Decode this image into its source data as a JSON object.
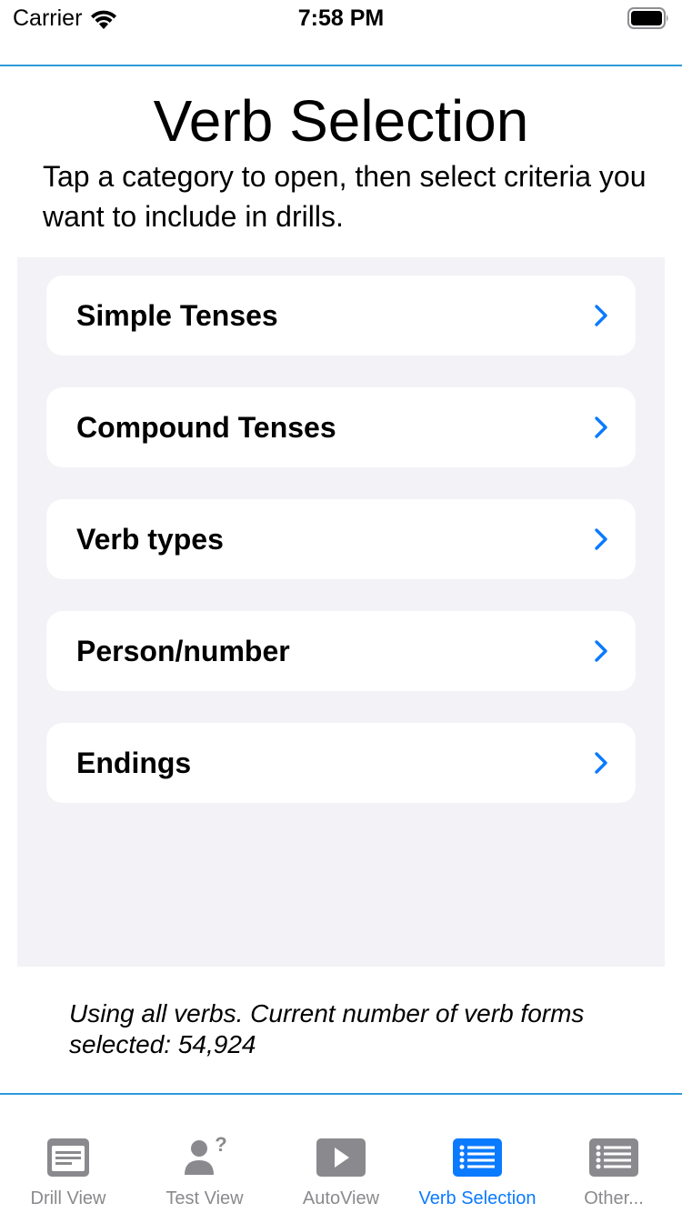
{
  "status_bar": {
    "carrier": "Carrier",
    "time": "7:58 PM"
  },
  "header": {
    "title": "Verb Selection",
    "instructions": "Tap a category to open, then select criteria you want to include in drills."
  },
  "categories": [
    {
      "label": "Simple Tenses"
    },
    {
      "label": "Compound Tenses"
    },
    {
      "label": "Verb types"
    },
    {
      "label": "Person/number"
    },
    {
      "label": "Endings"
    }
  ],
  "summary": "Using all verbs. Current number of verb forms selected: 54,924",
  "tabs": [
    {
      "label": "Drill View",
      "icon": "drill-view-icon",
      "active": false
    },
    {
      "label": "Test View",
      "icon": "test-view-icon",
      "active": false
    },
    {
      "label": "AutoView",
      "icon": "play-icon",
      "active": false
    },
    {
      "label": "Verb Selection",
      "icon": "list-icon",
      "active": true
    },
    {
      "label": "Other...",
      "icon": "more-list-icon",
      "active": false
    }
  ],
  "colors": {
    "accent": "#0a7aff",
    "rule": "#2f9bd8",
    "inactive_tab": "#8a8a8e",
    "group_background": "#f2f2f7"
  }
}
